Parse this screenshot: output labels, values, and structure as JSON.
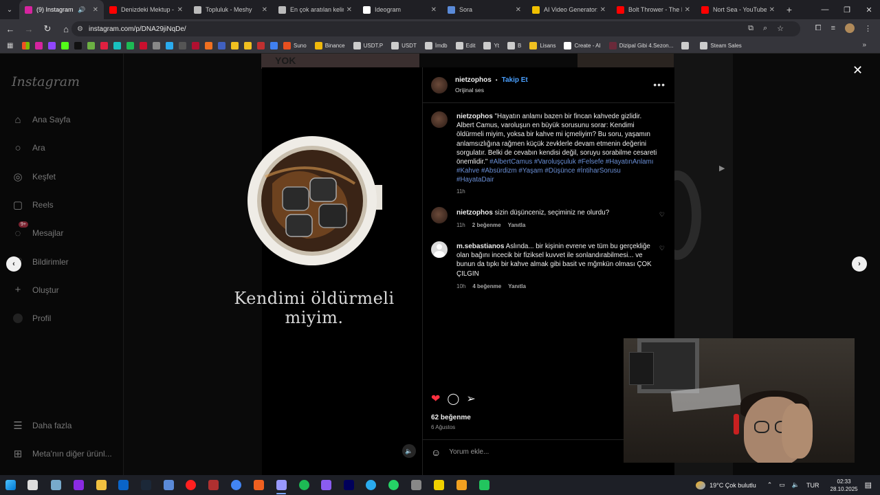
{
  "browser": {
    "tabs": [
      {
        "title": "(9) Instagram",
        "color": "#d6249f",
        "active": true
      },
      {
        "title": "Denizdeki Mektup - Y",
        "color": "#ff0000"
      },
      {
        "title": "Topluluk - Meshy",
        "color": "#bbbbbb"
      },
      {
        "title": "En çok aratılan kelime",
        "color": "#bbbbbb"
      },
      {
        "title": "Ideogram",
        "color": "#ffffff"
      },
      {
        "title": "Sora",
        "color": "#5a8ad8"
      },
      {
        "title": "AI Video Generator:",
        "color": "#f0c000"
      },
      {
        "title": "Bolt Thrower - The IV",
        "color": "#ff0000"
      },
      {
        "title": "Nort Sea - YouTube",
        "color": "#ff0000"
      }
    ],
    "url": "instagram.com/p/DNA29jiNqDe/",
    "bookmarks": [
      {
        "label": "Suno",
        "color": "#e85020"
      },
      {
        "label": "Binance",
        "color": "#f0b90b"
      },
      {
        "label": "USDT.P",
        "color": "#cccccc"
      },
      {
        "label": "USDT",
        "color": "#cccccc"
      },
      {
        "label": "İmdb",
        "color": "#cccccc"
      },
      {
        "label": "Edit",
        "color": "#cccccc"
      },
      {
        "label": "Yt",
        "color": "#cccccc"
      },
      {
        "label": "B",
        "color": "#cccccc"
      },
      {
        "label": "Lisans",
        "color": "#f0c020"
      },
      {
        "label": "Create - AI",
        "color": "#ffffff"
      },
      {
        "label": "Dizipal Gibi 4.Sezon...",
        "color": "#6a2a3a"
      },
      {
        "label": "",
        "color": "#cccccc"
      },
      {
        "label": "Steam Sales",
        "color": "#cccccc"
      }
    ]
  },
  "instagram": {
    "logo": "Instagram",
    "nav": [
      {
        "label": "Ana Sayfa",
        "icon": "home-icon",
        "glyph": "⌂"
      },
      {
        "label": "Ara",
        "icon": "search-icon",
        "glyph": "○"
      },
      {
        "label": "Keşfet",
        "icon": "explore-icon",
        "glyph": "◎"
      },
      {
        "label": "Reels",
        "icon": "reels-icon",
        "glyph": "▢"
      },
      {
        "label": "Mesajlar",
        "icon": "messages-icon",
        "glyph": "◌",
        "badge": "9+"
      },
      {
        "label": "Bildirimler",
        "icon": "heart-icon",
        "glyph": "♡"
      },
      {
        "label": "Oluştur",
        "icon": "plus-icon",
        "glyph": "+"
      },
      {
        "label": "Profil",
        "icon": "profile-icon",
        "glyph": ""
      }
    ],
    "more_label": "Daha fazla",
    "meta_label": "Meta'nın diğer ürünl...",
    "media_caption": "Kendimi öldürmeli miyim.",
    "post": {
      "username": "nietzophos",
      "follow": "Takip Et",
      "audio": "Orijinal ses",
      "caption_user": "nietzophos",
      "caption_text": "\"Hayatın anlamı bazen bir fincan kahvede gizlidir. Albert Camus, varoluşun en büyük sorusunu sorar: Kendimi öldürmeli miyim, yoksa bir kahve mi içmeliyim? Bu soru, yaşamın anlamsızlığına rağmen küçük zevklerle devam etmenin değerini sorgulatır. Belki de cevabın kendisi değil, soruyu sorabilme cesareti önemlidir.\"",
      "caption_tags": "#AlbertCamus #Varoluşçuluk #Felsefe #HayatınAnlamı #Kahve #Absürdizm #Yaşam #Düşünce #İntiharSorusu #HayataDair",
      "caption_time": "11h",
      "comments": [
        {
          "user": "nietzophos",
          "text": "sizin düşünceniz, seçiminiz ne olurdu?",
          "time": "11h",
          "likes": "2 beğenme",
          "reply": "Yanıtla"
        },
        {
          "user": "m.sebastianos",
          "text": "Aslında... bir kişinin evrene ve tüm bu gerçekliğe olan bağını incecik bir fiziksel kuvvet ile sonlandırabilmesi... ve bunun da tıpkı bir kahve almak gibi basit ve mğmkün olması ÇOK ÇILGIN",
          "time": "10h",
          "likes": "4 beğenme",
          "reply": "Yanıtla"
        }
      ],
      "like_count": "62 beğenme",
      "date": "6 Ağustos",
      "comment_placeholder": "Yorum ekle..."
    }
  },
  "taskbar": {
    "weather": "19°C  Çok bulutlu",
    "lang": "TUR",
    "time": "02:33",
    "date": "28.10.2025"
  }
}
